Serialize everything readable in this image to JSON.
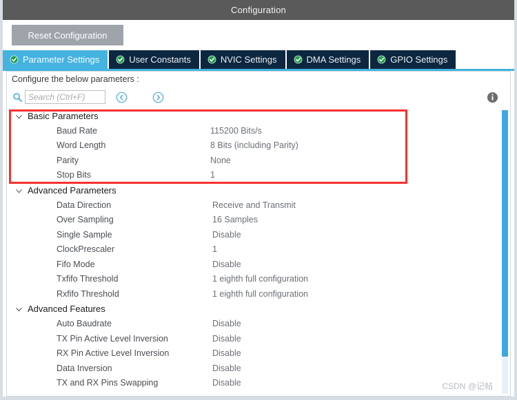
{
  "window": {
    "title": "Configuration"
  },
  "toolbar": {
    "reset_label": "Reset Configuration"
  },
  "tabs": [
    {
      "label": "Parameter Settings",
      "icon": "check-circle-icon",
      "active": true
    },
    {
      "label": "User Constants",
      "icon": "check-circle-icon",
      "active": false
    },
    {
      "label": "NVIC Settings",
      "icon": "check-circle-icon",
      "active": false
    },
    {
      "label": "DMA Settings",
      "icon": "check-circle-icon",
      "active": false
    },
    {
      "label": "GPIO Settings",
      "icon": "check-circle-icon",
      "active": false
    }
  ],
  "hint": {
    "text": "Configure the below parameters :"
  },
  "search": {
    "placeholder": "Search (Ctrl+F)",
    "value": "",
    "icon": "search-icon",
    "prev_icon": "circle-left-arrow-icon",
    "next_icon": "circle-right-arrow-icon",
    "info_icon": "info-icon"
  },
  "groups": [
    {
      "title": "Basic Parameters",
      "expanded": true,
      "highlighted": true,
      "rows": [
        {
          "label": "Baud Rate",
          "value": "115200 Bits/s"
        },
        {
          "label": "Word Length",
          "value": "8 Bits (including Parity)"
        },
        {
          "label": "Parity",
          "value": "None"
        },
        {
          "label": "Stop Bits",
          "value": "1"
        }
      ]
    },
    {
      "title": "Advanced Parameters",
      "expanded": true,
      "highlighted": false,
      "rows": [
        {
          "label": "Data Direction",
          "value": "Receive and Transmit"
        },
        {
          "label": "Over Sampling",
          "value": "16 Samples"
        },
        {
          "label": "Single Sample",
          "value": "Disable"
        },
        {
          "label": "ClockPrescaler",
          "value": "1"
        },
        {
          "label": "Fifo Mode",
          "value": "Disable"
        },
        {
          "label": "Txfifo Threshold",
          "value": "1 eighth full configuration"
        },
        {
          "label": "Rxfifo Threshold",
          "value": "1 eighth full configuration"
        }
      ]
    },
    {
      "title": "Advanced Features",
      "expanded": true,
      "highlighted": false,
      "rows": [
        {
          "label": "Auto Baudrate",
          "value": "Disable"
        },
        {
          "label": "TX Pin Active Level Inversion",
          "value": "Disable"
        },
        {
          "label": "RX Pin Active Level Inversion",
          "value": "Disable"
        },
        {
          "label": "Data Inversion",
          "value": "Disable"
        },
        {
          "label": "TX and RX Pins Swapping",
          "value": "Disable"
        }
      ]
    }
  ],
  "watermark": {
    "text": "CSDN @记帖"
  },
  "colors": {
    "titlebar": "#5a5a5a",
    "tab_active": "#44b3e0",
    "tab_inactive": "#0d2740",
    "highlight_box": "#f73030",
    "scrollbar": "#3da8e0",
    "reset_button": "#9fa4ab"
  }
}
